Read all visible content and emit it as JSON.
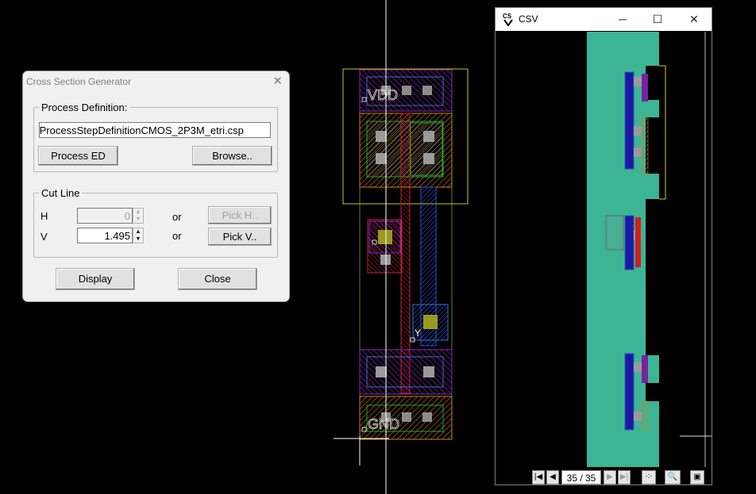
{
  "dialog": {
    "title": "Cross Section Generator",
    "process_group_label": "Process Definition:",
    "process_file_value": "\\ProcessStepDefinitionCMOS_2P3M_etri.csp",
    "process_ed_button": "Process ED",
    "browse_button": "Browse..",
    "cutline_group_label": "Cut Line",
    "h_label": "H",
    "h_value": "0",
    "v_label": "V",
    "v_value": "1.495",
    "or_label_1": "or",
    "or_label_2": "or",
    "pick_h_button": "Pick H..",
    "pick_v_button": "Pick V..",
    "display_button": "Display",
    "close_button": "Close"
  },
  "layout": {
    "vdd_label": "VDD",
    "gnd_label": "GND",
    "y_label": "Y"
  },
  "csv_window": {
    "title": "CSV",
    "page_indicator": "35 / 35",
    "minimize_glyph": "─",
    "maximize_glyph": "☐",
    "close_glyph": "✕"
  },
  "colors": {
    "background": "#000000",
    "substrate": "#3cb595",
    "metal1": "#1a1aa0",
    "poly": "#d02020",
    "diffusion": "#c0801a",
    "nwell": "#b0b020",
    "contact": "#9a9a9a",
    "via": "#9a9a20"
  }
}
